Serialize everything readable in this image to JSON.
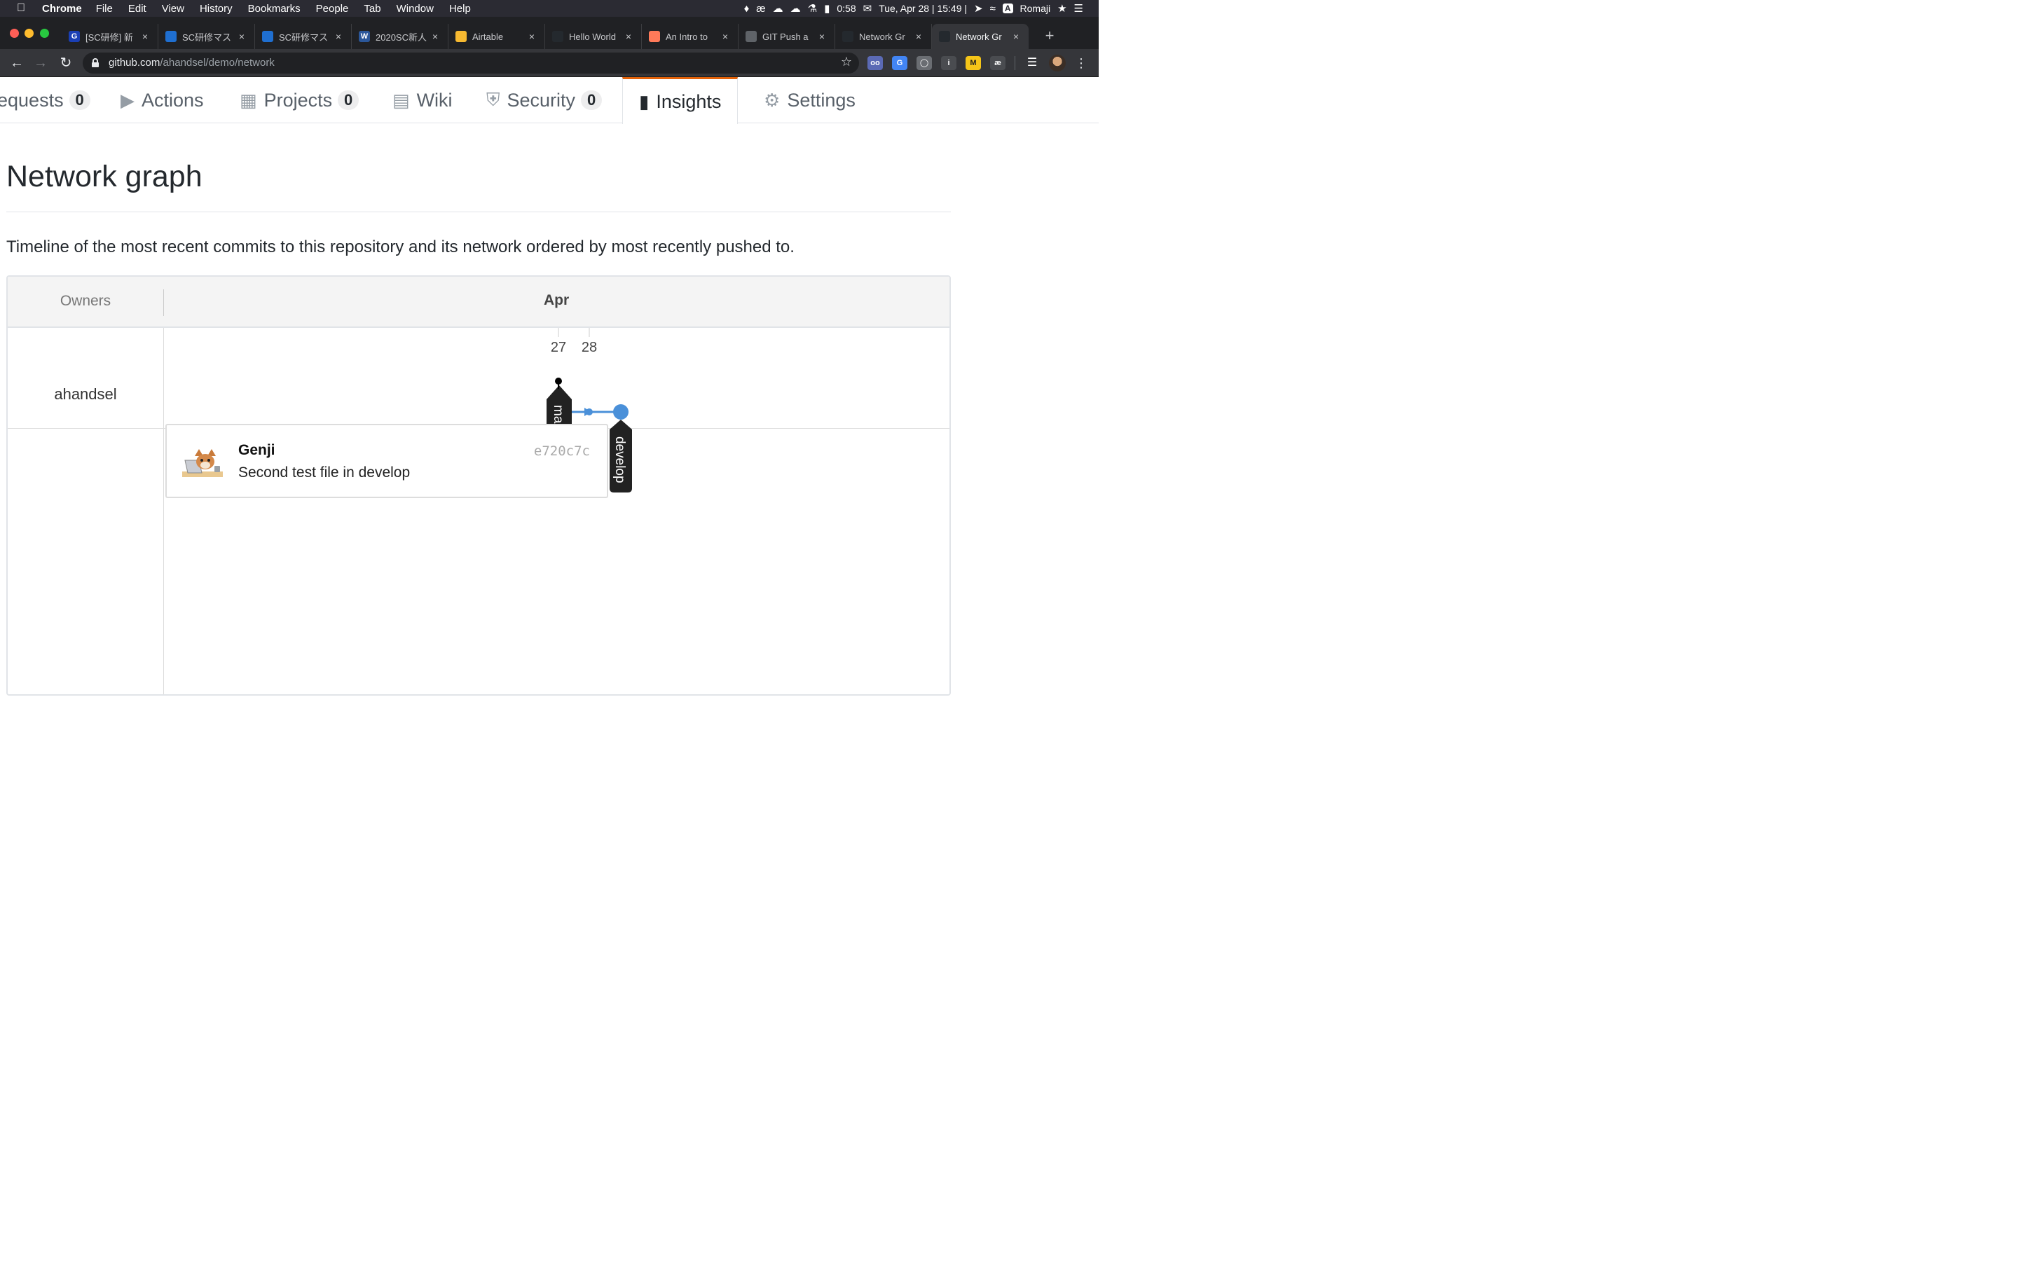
{
  "menubar": {
    "app": "Chrome",
    "items": [
      "File",
      "Edit",
      "View",
      "History",
      "Bookmarks",
      "People",
      "Tab",
      "Window",
      "Help"
    ],
    "battery_time": "0:58",
    "datetime": "Tue, Apr 28 | 15:49 |",
    "input_method": "Romaji"
  },
  "tabs": [
    {
      "title": "[SC研修] 新",
      "favicon_color": "#1a3fb5",
      "favicon_letter": "G"
    },
    {
      "title": "SC研修マス",
      "favicon_color": "#1f6fd1",
      "favicon_letter": ""
    },
    {
      "title": "SC研修マス",
      "favicon_color": "#1f6fd1",
      "favicon_letter": ""
    },
    {
      "title": "2020SC新人",
      "favicon_color": "#2b579a",
      "favicon_letter": "W"
    },
    {
      "title": "Airtable",
      "favicon_color": "#f6b931",
      "favicon_letter": ""
    },
    {
      "title": "Hello World",
      "favicon_color": "#24292e",
      "favicon_letter": ""
    },
    {
      "title": "An Intro to",
      "favicon_color": "#ff7a59",
      "favicon_letter": ""
    },
    {
      "title": "GIT Push a",
      "favicon_color": "#5f6368",
      "favicon_letter": ""
    },
    {
      "title": "Network Gr",
      "favicon_color": "#24292e",
      "favicon_letter": ""
    },
    {
      "title": "Network Gr",
      "favicon_color": "#24292e",
      "favicon_letter": "",
      "active": true
    }
  ],
  "address_bar": {
    "host": "github.com",
    "path": "/ahandsel/demo/network"
  },
  "repo_nav": {
    "pull_requests": {
      "label": "equests",
      "count": "0"
    },
    "actions": {
      "label": "Actions"
    },
    "projects": {
      "label": "Projects",
      "count": "0"
    },
    "wiki": {
      "label": "Wiki"
    },
    "security": {
      "label": "Security",
      "count": "0"
    },
    "insights": {
      "label": "Insights"
    },
    "settings": {
      "label": "Settings"
    }
  },
  "page": {
    "title": "Network graph",
    "subtitle": "Timeline of the most recent commits to this repository and its network ordered by most recently pushed to."
  },
  "graph": {
    "owners_header": "Owners",
    "month": "Apr",
    "days": [
      "27",
      "28"
    ],
    "owner": "ahandsel",
    "branches": [
      "master",
      "develop"
    ],
    "master_label_visible": "ma:",
    "colors": {
      "master": "#000000",
      "develop": "#4a90d9",
      "label_bg": "#222222"
    }
  },
  "commit_popup": {
    "author": "Genji",
    "message": "Second test file in develop",
    "sha": "e720c7c"
  }
}
